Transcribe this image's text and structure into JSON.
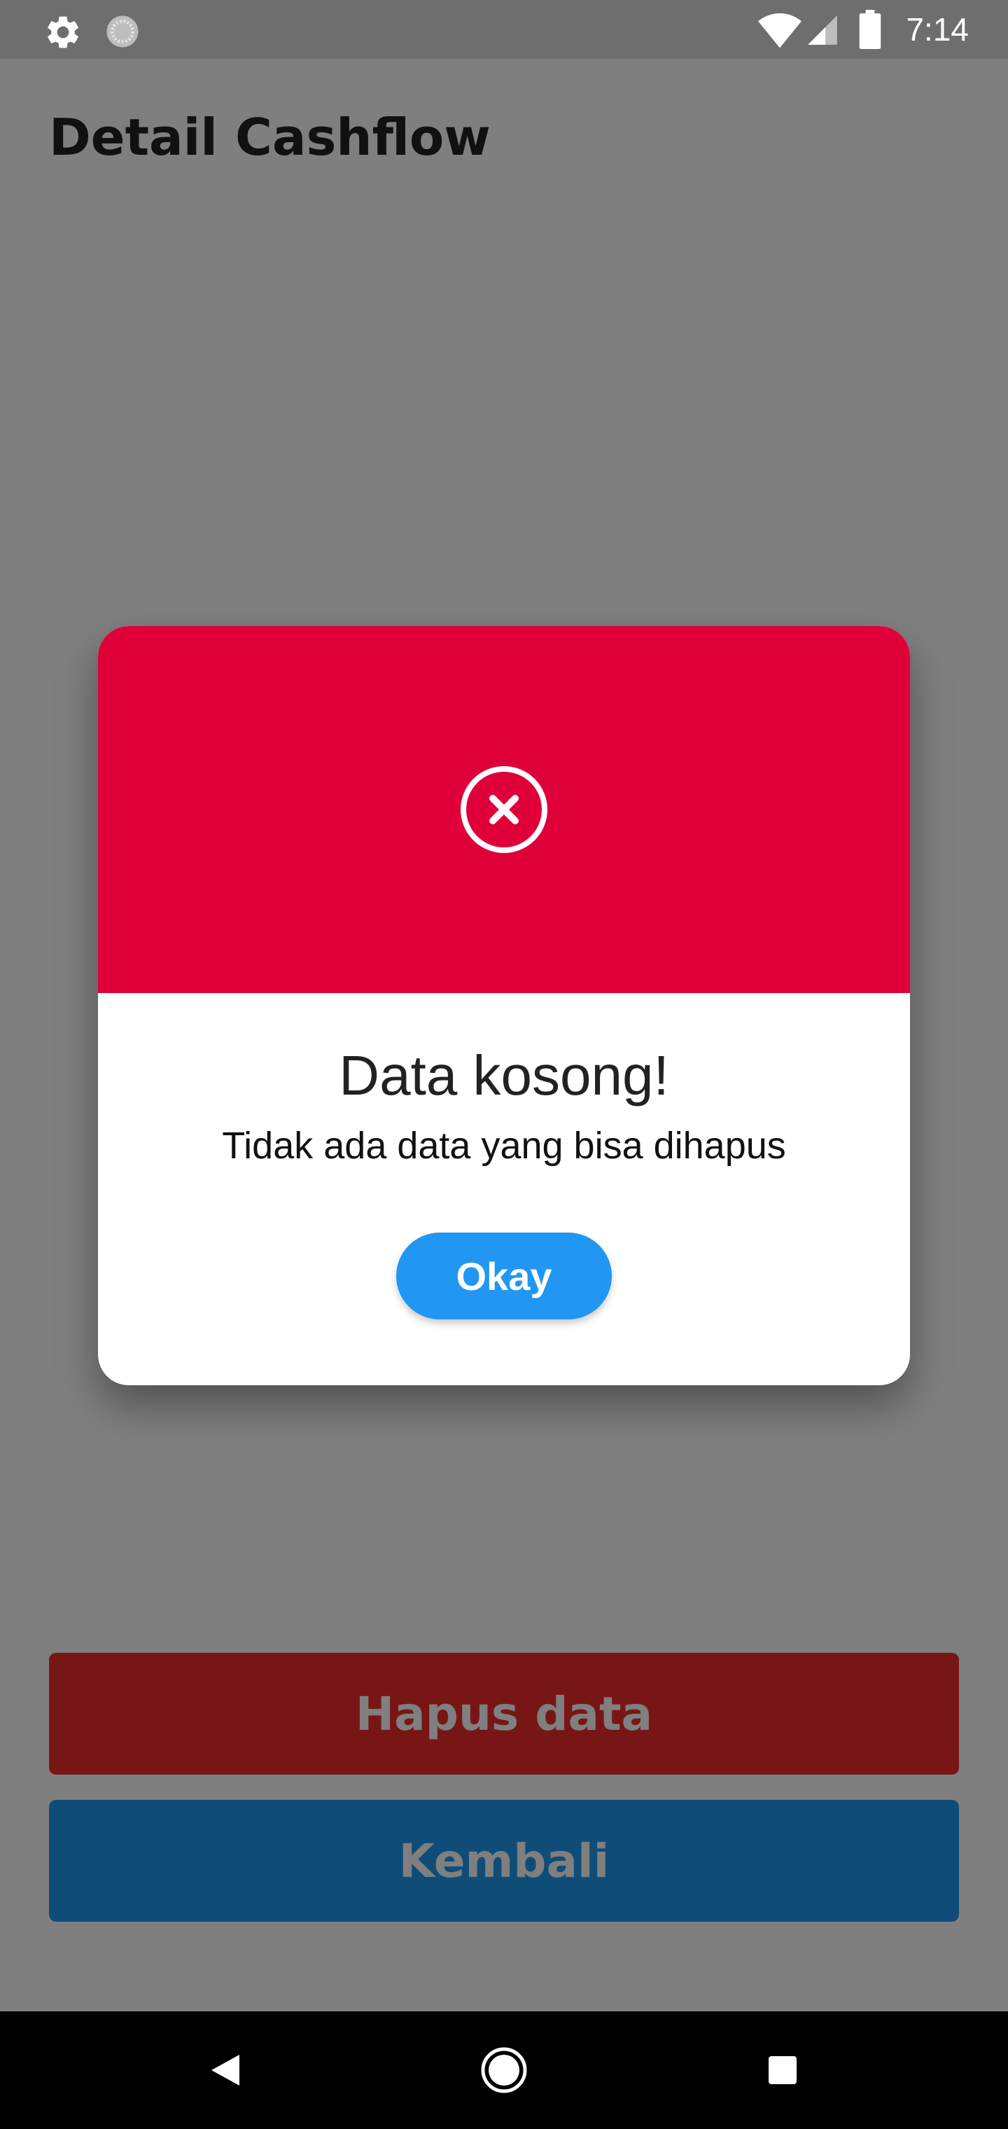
{
  "status_bar": {
    "time": "7:14",
    "left_icons": [
      "gear-icon",
      "loading-indicator-icon"
    ],
    "right_icons": [
      "wifi-icon",
      "signal-icon",
      "battery-icon"
    ]
  },
  "page": {
    "title": "Detail Cashflow",
    "delete_button_label": "Hapus data",
    "back_button_label": "Kembali"
  },
  "dialog": {
    "icon": "error-circle-x-icon",
    "title": "Data kosong!",
    "message": "Tidak ada data yang bisa dihapus",
    "ok_button_label": "Okay"
  },
  "nav_bar": {
    "buttons": [
      "back-triangle-icon",
      "home-circle-icon",
      "recents-square-icon"
    ]
  },
  "colors": {
    "dialog_header": "#df003a",
    "okay_button": "#2196f3",
    "delete_button": "#f12d2d",
    "back_button": "#1f9bf0",
    "scrim": "rgba(0,0,0,0.5)"
  }
}
